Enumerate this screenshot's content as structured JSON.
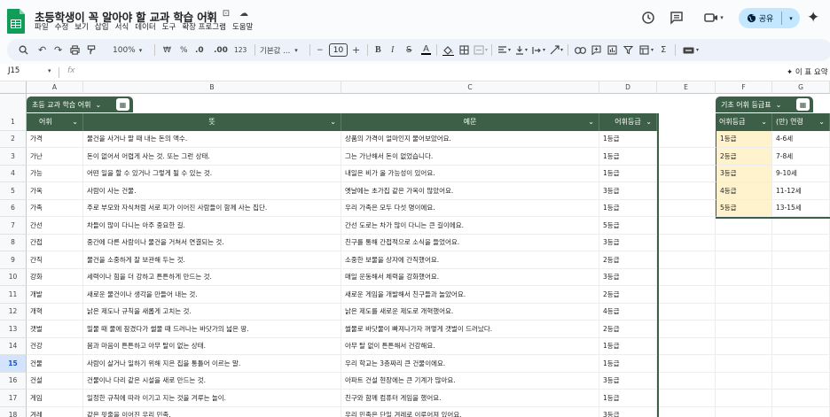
{
  "header": {
    "doc_title": "초등학생이 꼭 알아야 할 교과 학습 어휘",
    "menu": [
      "파일",
      "수정",
      "보기",
      "삽입",
      "서식",
      "데이터",
      "도구",
      "확장 프로그램",
      "도움말"
    ],
    "share_label": "공유"
  },
  "toolbar": {
    "zoom": "100%",
    "currency": "₩",
    "percent": "%",
    "dec_dec": ".0",
    "dec_inc": ".00",
    "num_fmt": "123",
    "font": "기본값 ...",
    "font_size": "10",
    "minus": "−",
    "plus": "+"
  },
  "formula_bar": {
    "cell_ref": "J15",
    "fx": "fx",
    "summary": "✦ 이 표 요약"
  },
  "columns": [
    "A",
    "B",
    "C",
    "D",
    "E",
    "F",
    "G"
  ],
  "table1": {
    "tab_label": "초등 교과 학습 어휘",
    "headers": [
      "어휘",
      "뜻",
      "예문",
      "어휘등급"
    ],
    "rows": [
      [
        "가격",
        "물건을 사거나 팔 때 내는 돈의 액수.",
        "상품의 가격이 얼마인지 물어보았어요.",
        "1등급"
      ],
      [
        "가난",
        "돈이 없어서 어렵게 사는 것. 또는 그런 상태.",
        "그는 가난해서 돈이 없었습니다.",
        "1등급"
      ],
      [
        "가능",
        "어떤 일을 할 수 있거나 그렇게 될 수 있는 것.",
        "내일은 비가 올 가능성이 있어요.",
        "1등급"
      ],
      [
        "가옥",
        "사람이 사는 건물.",
        "옛날에는 초가집 같은 가옥이 많았어요.",
        "3등급"
      ],
      [
        "가족",
        "주로 부모와 자식처럼 서로 피가 이어진 사람들이 함께 사는 집단.",
        "우리 가족은 모두 다섯 명이에요.",
        "1등급"
      ],
      [
        "간선",
        "차들이 많이 다니는 아주 중요한 길.",
        "간선 도로는 차가 많이 다니는 큰 길이에요.",
        "5등급"
      ],
      [
        "간접",
        "중간에 다른 사람이나 물건을 거쳐서 연결되는 것.",
        "친구를 통해 간접적으로 소식을 들었어요.",
        "3등급"
      ],
      [
        "간직",
        "물건을 소중하게 잘 보관해 두는 것.",
        "소중한 보물을 상자에 간직했어요.",
        "2등급"
      ],
      [
        "강화",
        "세력이나 힘을 더 강하고 튼튼하게 만드는 것.",
        "매일 운동해서 체력을 강화했어요.",
        "3등급"
      ],
      [
        "개발",
        "새로운 물건이나 생각을 만들어 내는 것.",
        "새로운 게임을 개발해서 친구들과 놀았어요.",
        "2등급"
      ],
      [
        "개혁",
        "낡은 제도나 규칙을 새롭게 고치는 것.",
        "낡은 제도를 새로운 제도로 개혁했어요.",
        "4등급"
      ],
      [
        "갯벌",
        "밀물 때 물에 잠겼다가 썰물 때 드러나는 바닷가의 넓은 땅.",
        "썰물로 바닷물이 빠져나가자 꺼멓게 갯벌이 드러났다.",
        "2등급"
      ],
      [
        "건강",
        "몸과 마음이 튼튼하고 아무 탈이 없는 상태.",
        "아무 탈 없이 튼튼해서 건강해요.",
        "1등급"
      ],
      [
        "건물",
        "사람이 살거나 일하기 위해 지은 집을 통틀어 이르는 말.",
        "우리 학교는 3층짜리 큰 건물이에요.",
        "1등급"
      ],
      [
        "건설",
        "건물이나 다리 같은 시설을 새로 만드는 것.",
        "아파트 건설 현장에는 큰 기계가 많아요.",
        "3등급"
      ],
      [
        "게임",
        "일정한 규칙에 따라 이기고 지는 것을 겨루는 놀이.",
        "친구와 함께 컴퓨터 게임을 했어요.",
        "1등급"
      ],
      [
        "겨레",
        "같은 핏줄을 이어진 우리 민족.",
        "우리 민족은 단일 겨레로 이루어져 있어요.",
        "3등급"
      ]
    ]
  },
  "table2": {
    "tab_label": "기초 어휘 등급표",
    "headers": [
      "어휘등급",
      "(만) 연령"
    ],
    "rows": [
      [
        "1등급",
        "4-6세"
      ],
      [
        "2등급",
        "7-8세"
      ],
      [
        "3등급",
        "9-10세"
      ],
      [
        "4등급",
        "11-12세"
      ],
      [
        "5등급",
        "13-15세"
      ]
    ]
  },
  "row_numbers": [
    "1",
    "2",
    "3",
    "4",
    "5",
    "6",
    "7",
    "8",
    "9",
    "10",
    "11",
    "12",
    "13",
    "14",
    "15",
    "16",
    "17",
    "18"
  ],
  "colors": {
    "table_header": "#3d5f48",
    "level_fill": "#fff3cd",
    "share_bg": "#c2e7ff"
  }
}
